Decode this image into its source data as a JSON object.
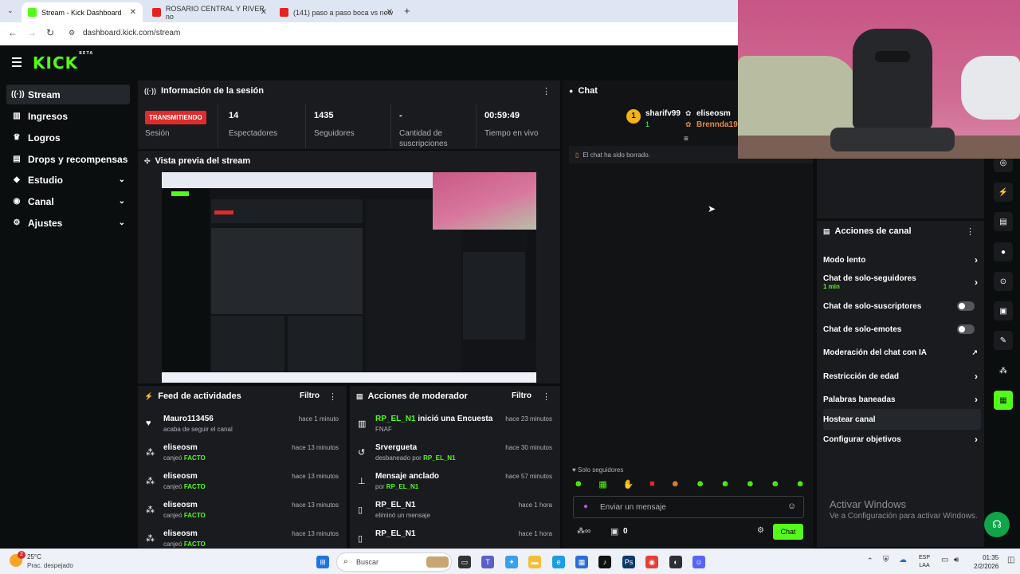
{
  "browser": {
    "tabs": [
      {
        "title": "Stream - Kick Dashboard",
        "icon": "kick-icon"
      },
      {
        "title": "ROSARIO CENTRAL Y RIVER no",
        "icon": "youtube-icon"
      },
      {
        "title": "(141) paso a paso boca vs new",
        "icon": "youtube-icon"
      }
    ],
    "url": "dashboard.kick.com/stream"
  },
  "app": {
    "logo": "KICK",
    "logo_sup": "BETA"
  },
  "sidebar": {
    "items": [
      {
        "label": "Stream",
        "icon": "broadcast-icon"
      },
      {
        "label": "Ingresos",
        "icon": "chart-icon"
      },
      {
        "label": "Logros",
        "icon": "trophy-icon"
      },
      {
        "label": "Drops y recompensas",
        "icon": "gift-icon"
      },
      {
        "label": "Estudio",
        "icon": "studio-icon"
      },
      {
        "label": "Canal",
        "icon": "channel-icon"
      },
      {
        "label": "Ajustes",
        "icon": "gear-icon"
      }
    ]
  },
  "session": {
    "title": "Información de la sesión",
    "status": "TRANSMITIENDO",
    "status_label": "Sesión",
    "stats": [
      {
        "value": "14",
        "label": "Espectadores"
      },
      {
        "value": "1435",
        "label": "Seguidores"
      },
      {
        "value": "-",
        "label": "Cantidad de suscripciones"
      },
      {
        "value": "00:59:49",
        "label": "Tiempo en vivo"
      }
    ]
  },
  "preview": {
    "title": "Vista previa del stream"
  },
  "activity": {
    "title": "Feed de actividades",
    "filter": "Filtro",
    "items": [
      {
        "name": "Mauro113456",
        "desc": "acaba de seguir el canal",
        "highlight": "",
        "time": "hace 1 minuto",
        "icon": "heart-icon"
      },
      {
        "name": "eliseosm",
        "desc": "canjeó",
        "highlight": "FACTO",
        "time": "hace 13 minutos",
        "icon": "points-icon"
      },
      {
        "name": "eliseosm",
        "desc": "canjeó",
        "highlight": "FACTO",
        "time": "hace 13 minutos",
        "icon": "points-icon"
      },
      {
        "name": "eliseosm",
        "desc": "canjeó",
        "highlight": "FACTO",
        "time": "hace 13 minutos",
        "icon": "points-icon"
      },
      {
        "name": "eliseosm",
        "desc": "canjeó",
        "highlight": "FACTO",
        "time": "hace 13 minutos",
        "icon": "points-icon"
      }
    ]
  },
  "modactions": {
    "title": "Acciones de moderador",
    "filter": "Filtro",
    "items": [
      {
        "user": "RP_EL_N1",
        "action": "inició una Encuesta",
        "sub": "FNAF",
        "sub_user": "",
        "time": "hace 23 minutos",
        "icon": "poll-icon"
      },
      {
        "user": "",
        "action": "Srvergueta",
        "sub": "desbaneado por",
        "sub_user": "RP_EL_N1",
        "time": "hace 30 minutos",
        "icon": "undo-icon"
      },
      {
        "user": "",
        "action": "Mensaje anclado",
        "sub": "por",
        "sub_user": "RP_EL_N1",
        "time": "hace 57 minutos",
        "icon": "pin-icon"
      },
      {
        "user": "",
        "action": "RP_EL_N1",
        "sub": "eliminó un mensaje",
        "sub_user": "",
        "time": "hace 1 hora",
        "icon": "trash-icon"
      },
      {
        "user": "",
        "action": "RP_EL_N1",
        "sub": "",
        "sub_user": "",
        "time": "hace 1 hora",
        "icon": "trash-icon"
      }
    ]
  },
  "chat": {
    "title": "Chat",
    "top_users": [
      {
        "rank": "1",
        "name": "sharifv99",
        "count": "1"
      },
      {
        "rank": "",
        "name": "eliseosm",
        "count": ""
      },
      {
        "rank": "",
        "name": "Brennda19",
        "count": ""
      }
    ],
    "system_message": "El chat ha sido borrado.",
    "mode_label": "Solo seguidores",
    "input_placeholder": "Enviar un mensaje",
    "points": "0",
    "send_label": "Chat"
  },
  "channel_actions": {
    "title": "Acciones de canal",
    "items": [
      {
        "label": "Modo lento",
        "sub": "",
        "control": "arrow"
      },
      {
        "label": "Chat de solo-seguidores",
        "sub": "1 min",
        "control": "arrow"
      },
      {
        "label": "Chat de solo-suscriptores",
        "sub": "",
        "control": "toggle"
      },
      {
        "label": "Chat de solo-emotes",
        "sub": "",
        "control": "toggle"
      },
      {
        "label": "Moderación del chat con IA",
        "sub": "",
        "control": "external"
      },
      {
        "label": "Restricción de edad",
        "sub": "",
        "control": "arrow"
      },
      {
        "label": "Palabras baneadas",
        "sub": "",
        "control": "arrow"
      },
      {
        "label": "Hostear canal",
        "sub": "",
        "control": "none"
      },
      {
        "label": "Configurar objetivos",
        "sub": "",
        "control": "arrow"
      }
    ]
  },
  "watermark": {
    "title": "Activar Windows",
    "subtitle": "Ve a Configuración para activar Windows."
  },
  "taskbar": {
    "weather_temp": "25°C",
    "weather_desc": "Prac. despejado",
    "weather_badge": "2",
    "search_placeholder": "Buscar",
    "lang_top": "ESP",
    "lang_bottom": "LAA",
    "time": "01:35",
    "date": "2/2/2026"
  },
  "colors": {
    "accent": "#53fc18",
    "live": "#e02b2b",
    "panel": "#191b1f",
    "background": "#0b0e0f"
  }
}
